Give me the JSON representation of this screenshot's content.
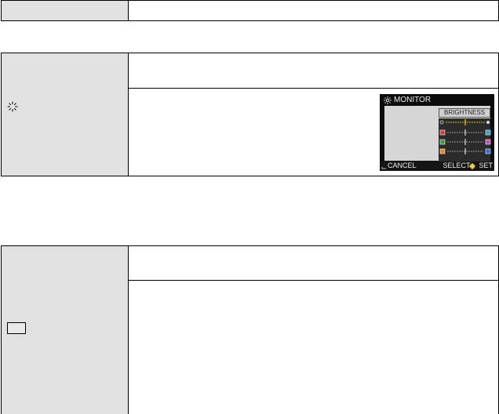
{
  "camera_screen": {
    "menu_title": "MONITOR",
    "setting_label": "BRIGHTNESS",
    "cancel_label": "CANCEL",
    "select_label": "SELECT",
    "set_label": "SET",
    "swatch_colors": [
      "#d23b3b",
      "#3a9a3a",
      "#e08a1e",
      "#2aa6c9"
    ],
    "icons": [
      "sun-icon",
      "return-arrow-icon",
      "cross-key-icon"
    ]
  },
  "colors": {
    "label_cell_bg": "#e1e1e1",
    "border": "#000000"
  }
}
